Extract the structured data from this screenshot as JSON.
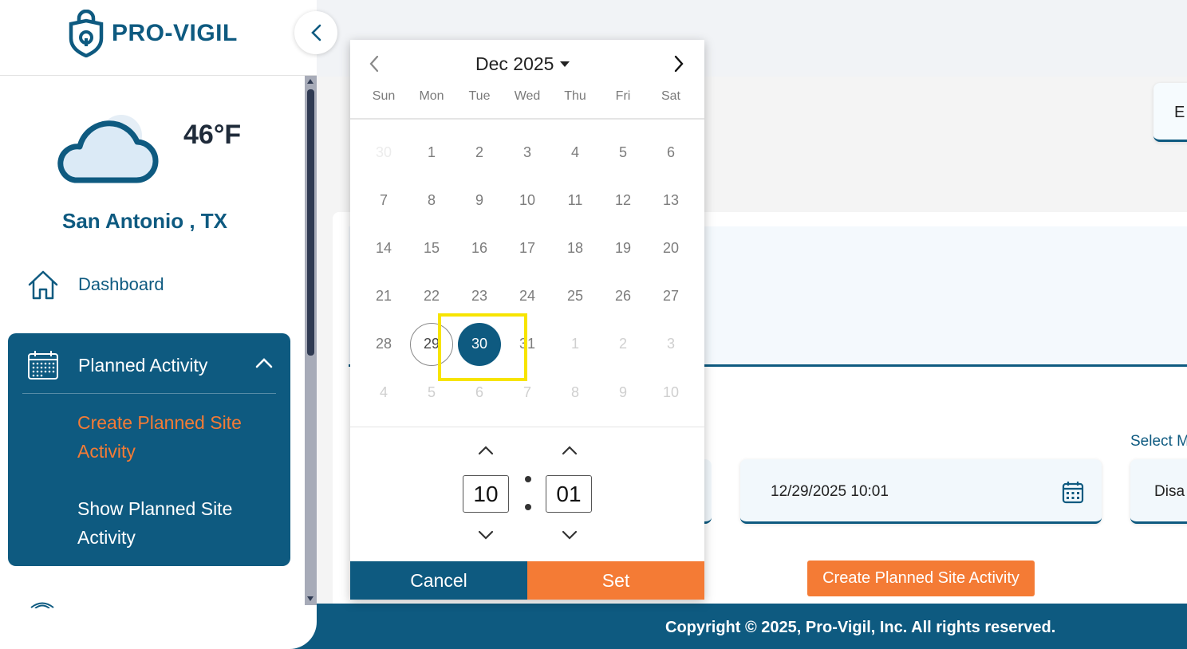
{
  "brand": {
    "name": "PRO-VIGIL",
    "primary": "#0e5a80",
    "accent": "#f47b35",
    "icon": "shield-lock-icon"
  },
  "weather": {
    "temperature": "46°F",
    "location": "San Antonio , TX",
    "icon": "cloud-icon"
  },
  "sidebar": {
    "dashboard": {
      "label": "Dashboard",
      "icon": "home-icon"
    },
    "planned_activity": {
      "label": "Planned Activity",
      "icon": "calendar-grid-icon",
      "expanded": true,
      "items": [
        {
          "label": "Create Planned Site Activity",
          "active": true
        },
        {
          "label": "Show Planned Site Activity",
          "active": false
        }
      ]
    }
  },
  "form": {
    "partial_card_text": "E",
    "date_value": "12/29/2025 10:01",
    "select_label": "Select M",
    "select_value": "Disa",
    "create_button": "Create Planned Site Activity"
  },
  "datepicker": {
    "month_label": "Dec 2025",
    "weekdays": [
      "Sun",
      "Mon",
      "Tue",
      "Wed",
      "Thu",
      "Fri",
      "Sat"
    ],
    "weeks": [
      [
        "30",
        "1",
        "2",
        "3",
        "4",
        "5",
        "6"
      ],
      [
        "7",
        "8",
        "9",
        "10",
        "11",
        "12",
        "13"
      ],
      [
        "14",
        "15",
        "16",
        "17",
        "18",
        "19",
        "20"
      ],
      [
        "21",
        "22",
        "23",
        "24",
        "25",
        "26",
        "27"
      ],
      [
        "28",
        "29",
        "30",
        "31",
        "1",
        "2",
        "3"
      ],
      [
        "4",
        "5",
        "6",
        "7",
        "8",
        "9",
        "10"
      ]
    ],
    "today": "29",
    "selected": "30",
    "hour": "10",
    "minute": "01",
    "cancel_label": "Cancel",
    "set_label": "Set"
  },
  "footer": {
    "copyright": "Copyright © 2025, Pro-Vigil, Inc. All rights reserved."
  }
}
